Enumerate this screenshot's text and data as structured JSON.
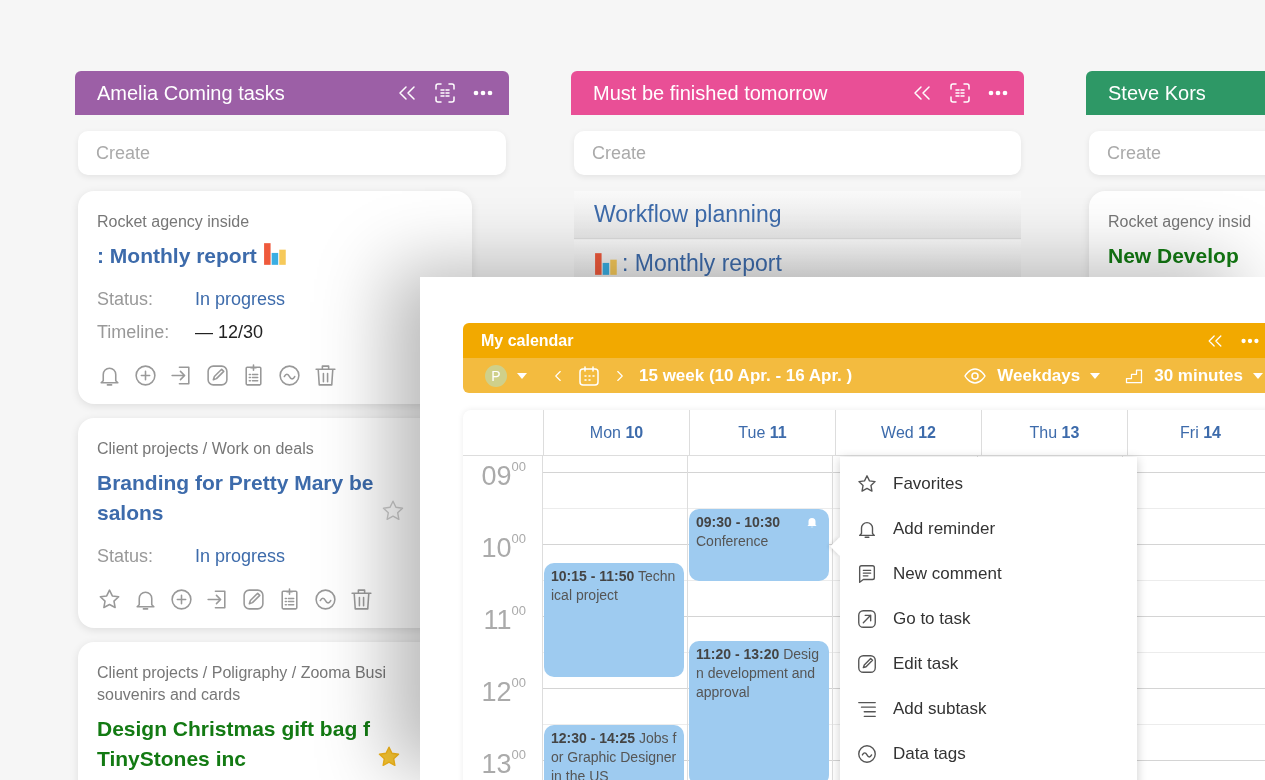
{
  "board": {
    "columns": [
      {
        "title": "Amelia Coming tasks",
        "color": "#9c5fa6",
        "tools": true,
        "create_placeholder": "Create",
        "cards": [
          {
            "kind": "card",
            "path": [
              "Rocket agency inside"
            ],
            "title": [
              ": Monthly report"
            ],
            "title_icon": {
              "kind": "chart"
            },
            "color": "#3d6bab",
            "fields": [
              {
                "kind": "status",
                "label": "Status:",
                "value": "In progress"
              },
              {
                "kind": "plain",
                "label": "Timeline:",
                "value": "— 12/30"
              }
            ],
            "actions": [
              {
                "kind": "bell"
              },
              {
                "kind": "plus"
              },
              {
                "kind": "enter"
              },
              {
                "kind": "edit"
              },
              {
                "kind": "checklist"
              },
              {
                "kind": "tags"
              },
              {
                "kind": "trash"
              }
            ]
          },
          {
            "kind": "card",
            "path": [
              "Client projects / Work on deals"
            ],
            "title": [
              "Branding for Pretty Mary be",
              "salons"
            ],
            "starred": false,
            "color": "#3d6bab",
            "fields": [
              {
                "kind": "status",
                "label": "Status:",
                "value": "In progress"
              }
            ],
            "actions": [
              {
                "kind": "star"
              },
              {
                "kind": "bell"
              },
              {
                "kind": "plus"
              },
              {
                "kind": "enter"
              },
              {
                "kind": "edit"
              },
              {
                "kind": "checklist"
              },
              {
                "kind": "tags"
              },
              {
                "kind": "trash"
              }
            ]
          },
          {
            "kind": "card",
            "path": [
              "Client projects / Poligraphy / Zooma Busi",
              "souvenirs and cards"
            ],
            "title": [
              "Design Christmas gift bag f",
              "TinyStones inc"
            ],
            "starred": true,
            "color": "#137a13"
          }
        ]
      },
      {
        "title": "Must be finished tomorrow",
        "color": "#e94f96",
        "tools": true,
        "create_placeholder": "Create",
        "cards": [
          {
            "kind": "row",
            "title": [
              "Workflow planning"
            ]
          },
          {
            "kind": "row",
            "title": [
              ": Monthly report"
            ],
            "title_icon": {
              "kind": "chart"
            }
          }
        ]
      },
      {
        "title": "Steve Kors",
        "color": "#2e9866",
        "create_placeholder": "Create",
        "cards": [
          {
            "kind": "card",
            "path": [
              "Rocket agency insid"
            ],
            "title": [
              "New Develop"
            ],
            "color": "#137a13"
          }
        ]
      }
    ]
  },
  "calendar": {
    "title": "My calendar",
    "user_initial": "P",
    "week": "15 week  (10 Apr. - 16 Apr. )",
    "view": "Weekdays",
    "step": "30 minutes",
    "hours": [
      {
        "hour": "09",
        "minutes": "00"
      },
      {
        "hour": "10",
        "minutes": "00"
      },
      {
        "hour": "11",
        "minutes": "00"
      },
      {
        "hour": "12",
        "minutes": "00"
      },
      {
        "hour": "13",
        "minutes": "00"
      }
    ],
    "days": [
      {
        "label": "Mon **10**",
        "events": [
          {
            "time": "10:15 - 11:50",
            "title": "Technical project",
            "reminder": false
          },
          {
            "time": "12:30 - 14:25",
            "title": "Jobs for Graphic Designer in the US",
            "reminder": false
          }
        ]
      },
      {
        "label": "Tue **11**",
        "events": [
          {
            "time": "09:30 - 10:30",
            "title": "Conference",
            "reminder": true
          },
          {
            "time": "11:20 - 13:20",
            "title": "Design development and approval",
            "reminder": false
          }
        ]
      },
      {
        "label": "Wed **12**"
      },
      {
        "label": "Thu **13**"
      },
      {
        "label": "Fri **14**"
      }
    ],
    "menu": {
      "items": [
        {
          "kind": "favorite",
          "label": "Favorites"
        },
        {
          "kind": "reminder",
          "label": "Add reminder"
        },
        {
          "kind": "comment",
          "label": "New comment"
        },
        {
          "kind": "goto",
          "label": "Go to task"
        },
        {
          "kind": "edit",
          "label": "Edit task"
        },
        {
          "kind": "subtask",
          "label": "Add subtask"
        },
        {
          "kind": "tags",
          "label": "Data tags"
        }
      ]
    }
  }
}
